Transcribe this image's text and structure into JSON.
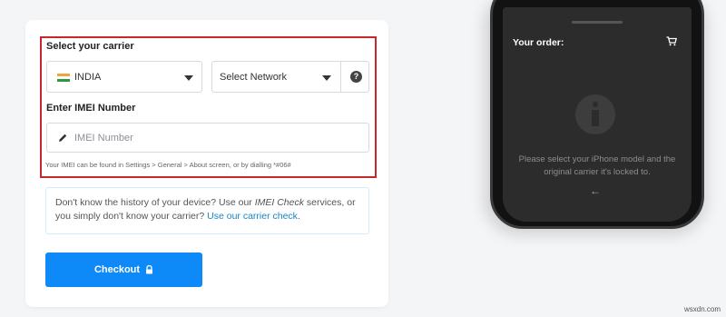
{
  "carrier": {
    "heading": "Select your carrier",
    "country": "INDIA",
    "network_placeholder": "Select Network",
    "help_glyph": "?"
  },
  "imei": {
    "heading": "Enter IMEI Number",
    "placeholder": "IMEI Number",
    "hint": "Your IMEI can be found in Settings > General > About screen, or by dialling *#06#"
  },
  "info_box": {
    "text_before": "Don't know the history of your device? Use our ",
    "imei_check": "IMEI Check",
    "text_middle": " services, or you simply don't know your carrier? ",
    "carrier_link": "Use our carrier check",
    "text_end": "."
  },
  "checkout": {
    "label": "Checkout"
  },
  "order_panel": {
    "title": "Your order:",
    "message": "Please select your iPhone model and the original carrier it's locked to.",
    "back_glyph": "←"
  },
  "watermark": "wsxdn.com",
  "colors": {
    "accent": "#0d8af7",
    "highlight_border": "#c9252c",
    "link": "#1686c4"
  },
  "icons": [
    "india-flag-icon",
    "chevron-down-icon",
    "help-icon",
    "pencil-icon",
    "lock-icon",
    "cart-icon",
    "info-icon",
    "back-arrow-icon"
  ]
}
